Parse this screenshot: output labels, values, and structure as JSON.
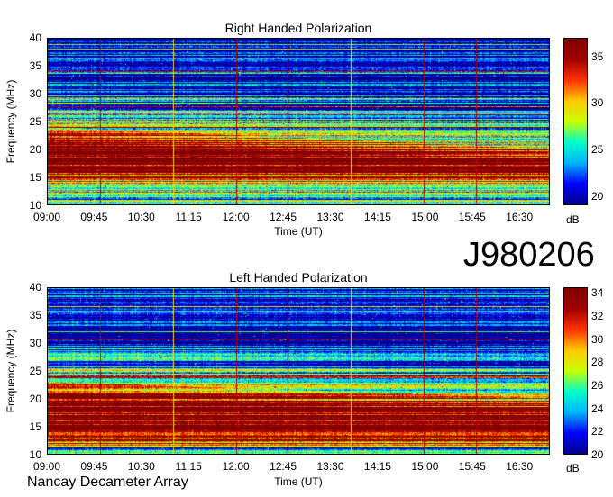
{
  "observation_id": "J980206",
  "instrument": "Nancay Decameter Array",
  "chart_data": [
    {
      "type": "heatmap",
      "title": "Right Handed Polarization",
      "xlabel": "Time (UT)",
      "ylabel": "Frequency (MHz)",
      "x_ticks": [
        "09:00",
        "09:45",
        "10:30",
        "11:15",
        "12:00",
        "12:45",
        "13:30",
        "14:15",
        "15:00",
        "15:45",
        "16:30"
      ],
      "x_range": [
        "09:00",
        "16:59"
      ],
      "y_ticks": [
        10,
        15,
        20,
        25,
        30,
        35,
        40
      ],
      "ylim": [
        10,
        40
      ],
      "colorbar": {
        "label": "dB",
        "ticks": [
          20,
          25,
          30,
          35
        ],
        "range": [
          19,
          37
        ]
      },
      "colormap": [
        "#00008f",
        "#0000ff",
        "#00b4ff",
        "#00ffc8",
        "#c8ff00",
        "#ffc800",
        "#ff3200",
        "#a00000",
        "#800000"
      ],
      "emission_band_mhz": {
        "start_low": 14,
        "start_high": 24,
        "end_low": 14,
        "end_high": 20,
        "peak_db": 37
      },
      "vertical_lines": [
        "09:50",
        "11:00",
        "12:00",
        "12:50",
        "13:50",
        "15:00",
        "15:50"
      ]
    },
    {
      "type": "heatmap",
      "title": "Left Handed Polarization",
      "xlabel": "Time (UT)",
      "ylabel": "Frequency (MHz)",
      "x_ticks": [
        "09:00",
        "09:45",
        "10:30",
        "11:15",
        "12:00",
        "12:45",
        "13:30",
        "14:15",
        "15:00",
        "15:45",
        "16:30"
      ],
      "x_range": [
        "09:00",
        "16:59"
      ],
      "y_ticks": [
        10,
        15,
        20,
        25,
        30,
        35,
        40
      ],
      "ylim": [
        10,
        40
      ],
      "colorbar": {
        "label": "dB",
        "ticks": [
          20,
          22,
          24,
          26,
          28,
          30,
          32,
          34
        ],
        "range": [
          20,
          34.5
        ]
      },
      "colormap": [
        "#00008f",
        "#0000ff",
        "#00b4ff",
        "#00ffc8",
        "#c8ff00",
        "#ffc800",
        "#ff3200",
        "#a00000",
        "#800000"
      ],
      "emission_band_mhz": {
        "start_low": 11,
        "start_high": 23,
        "end_low": 11,
        "end_high": 20,
        "peak_db": 34
      },
      "vertical_lines": [
        "09:50",
        "11:00",
        "12:00",
        "12:50",
        "13:50",
        "15:00",
        "15:50"
      ]
    }
  ]
}
